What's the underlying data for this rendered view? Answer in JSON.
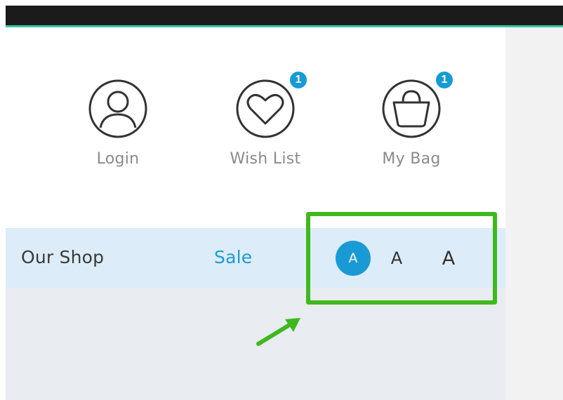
{
  "header": {
    "login": {
      "label": "Login",
      "icon": "user-icon"
    },
    "wishlist": {
      "label": "Wish List",
      "icon": "heart-icon",
      "badge": "1"
    },
    "bag": {
      "label": "My Bag",
      "icon": "bag-icon",
      "badge": "1"
    }
  },
  "nav": {
    "shop_label": "Our Shop",
    "sale_label": "Sale"
  },
  "font_size_controls": {
    "small": "A",
    "medium": "A",
    "large": "A",
    "selected": "small"
  },
  "annotation": {
    "highlight_color": "#3fb81e",
    "arrow_icon": "arrow-up-right-icon"
  },
  "colors": {
    "accent": "#1a9ad5",
    "nav_background": "#dcecf8",
    "topbar": "#1b1b1b",
    "topbar_line": "#39c7a7"
  }
}
